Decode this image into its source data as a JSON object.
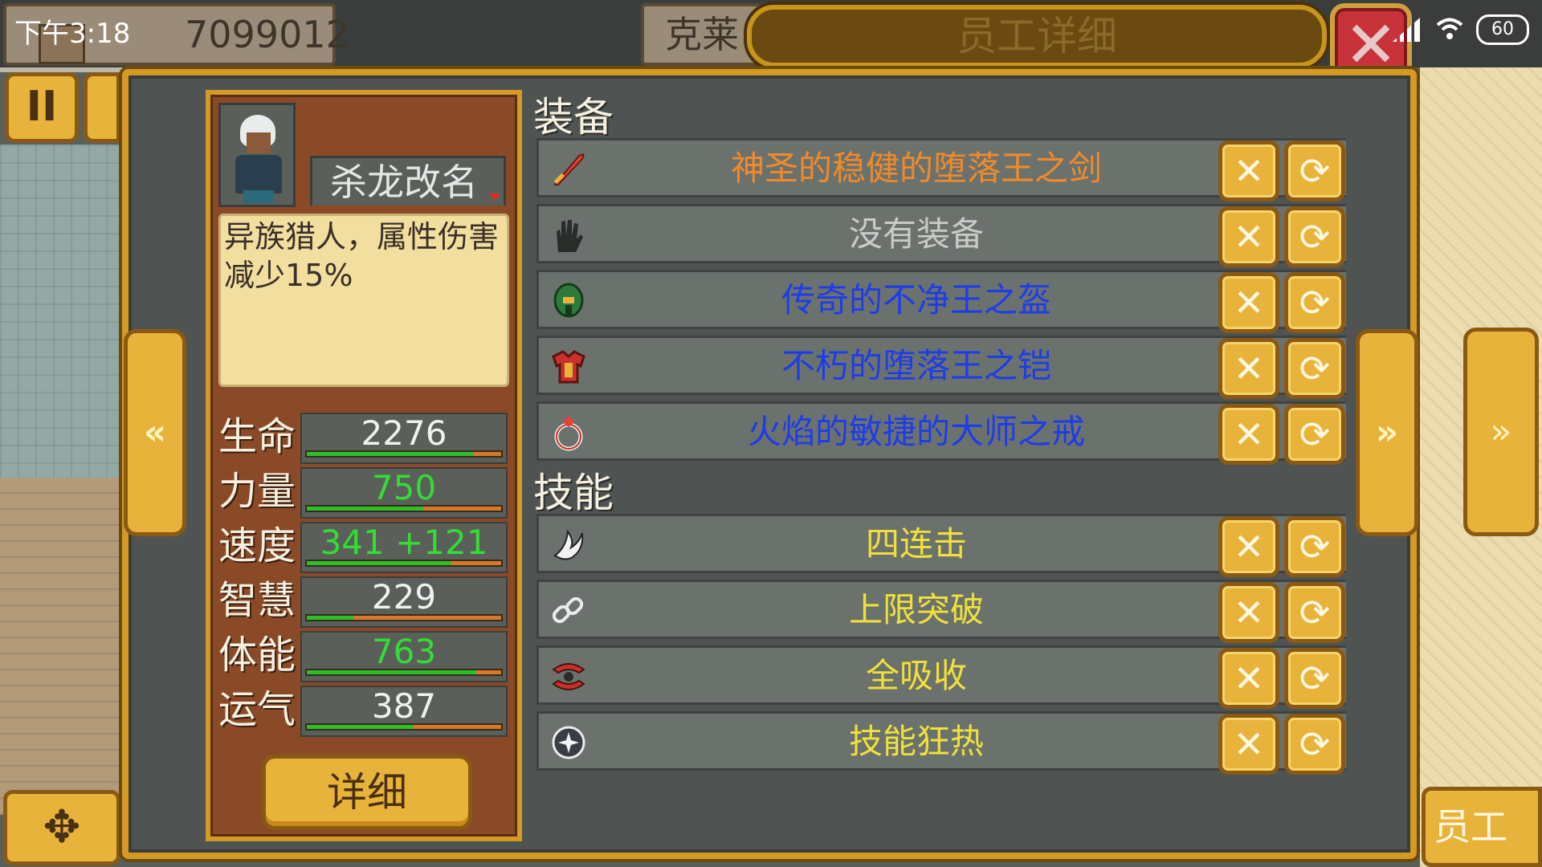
{
  "status_bar": {
    "time": "下午3:18",
    "battery": "60"
  },
  "top_bar": {
    "money": "7099012",
    "company_name": "克莱",
    "dialog_title": "员工详细"
  },
  "employee": {
    "name": "杀龙改名",
    "description": "异族猎人，属性伤害\n减少15%",
    "stats": [
      {
        "label": "生命",
        "value": "2276",
        "color": "#f0f0f0",
        "fill": 0.86
      },
      {
        "label": "力量",
        "value": "750",
        "color": "#33dd33",
        "fill": 0.6
      },
      {
        "label": "速度",
        "value": "341 +121",
        "color": "#33dd33",
        "fill": 0.74
      },
      {
        "label": "智慧",
        "value": "229",
        "color": "#f0f0f0",
        "fill": 0.24
      },
      {
        "label": "体能",
        "value": "763",
        "color": "#33dd33",
        "fill": 0.87
      },
      {
        "label": "运气",
        "value": "387",
        "color": "#f0f0f0",
        "fill": 0.55
      }
    ],
    "detail_button": "详细"
  },
  "equipment": {
    "title": "装备",
    "items": [
      {
        "name": "神圣的稳健的堕落王之剑",
        "color": "#f08a2a",
        "icon": "sword-icon"
      },
      {
        "name": "没有装备",
        "color": "#c8ccc8",
        "icon": "glove-icon"
      },
      {
        "name": "传奇的不净王之盔",
        "color": "#1e3ce8",
        "icon": "helmet-icon"
      },
      {
        "name": "不朽的堕落王之铠",
        "color": "#1e3ce8",
        "icon": "armor-icon"
      },
      {
        "name": "火焰的敏捷的大师之戒",
        "color": "#1e3ce8",
        "icon": "ring-icon"
      }
    ]
  },
  "skills": {
    "title": "技能",
    "items": [
      {
        "name": "四连击",
        "color": "#f0e03a",
        "icon": "claw-icon"
      },
      {
        "name": "上限突破",
        "color": "#f0e03a",
        "icon": "chain-icon"
      },
      {
        "name": "全吸收",
        "color": "#f0e03a",
        "icon": "absorb-icon"
      },
      {
        "name": "技能狂热",
        "color": "#f0e03a",
        "icon": "orb-icon"
      }
    ]
  },
  "buttons": {
    "remove_glyph": "✕",
    "swap_glyph": "⟳",
    "prev_glyph": "«",
    "next_glyph": "»",
    "pause_glyph": "II",
    "dpad_glyph": "✥"
  },
  "side_buttons": {
    "staff": "员工"
  }
}
